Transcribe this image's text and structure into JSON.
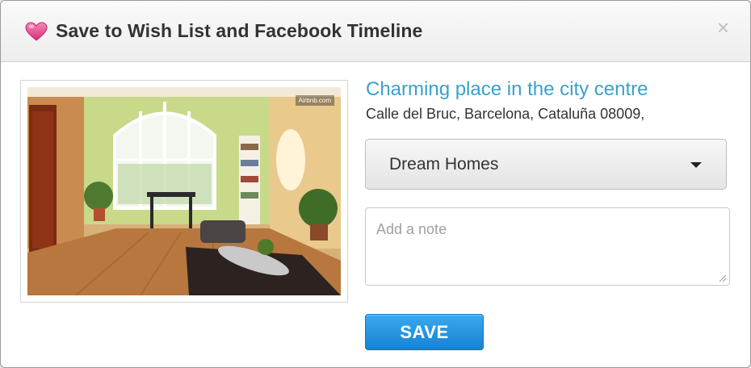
{
  "modal": {
    "title": "Save to Wish List and Facebook Timeline",
    "close_glyph": "×",
    "icons": {
      "title_icon": "heart-icon",
      "close": "close-icon"
    }
  },
  "listing": {
    "title": "Charming place in the city centre",
    "address": "Calle del Bruc, Barcelona, Cataluña 08009,",
    "photo_watermark": "Airbnb.com"
  },
  "form": {
    "wishlist_selected": "Dream Homes",
    "note_placeholder": "Add a note",
    "note_value": "",
    "save_label": "SAVE"
  },
  "colors": {
    "accent_blue": "#3aa0cc",
    "save_button": "#1f8fdf",
    "heart": "#e8478c"
  }
}
